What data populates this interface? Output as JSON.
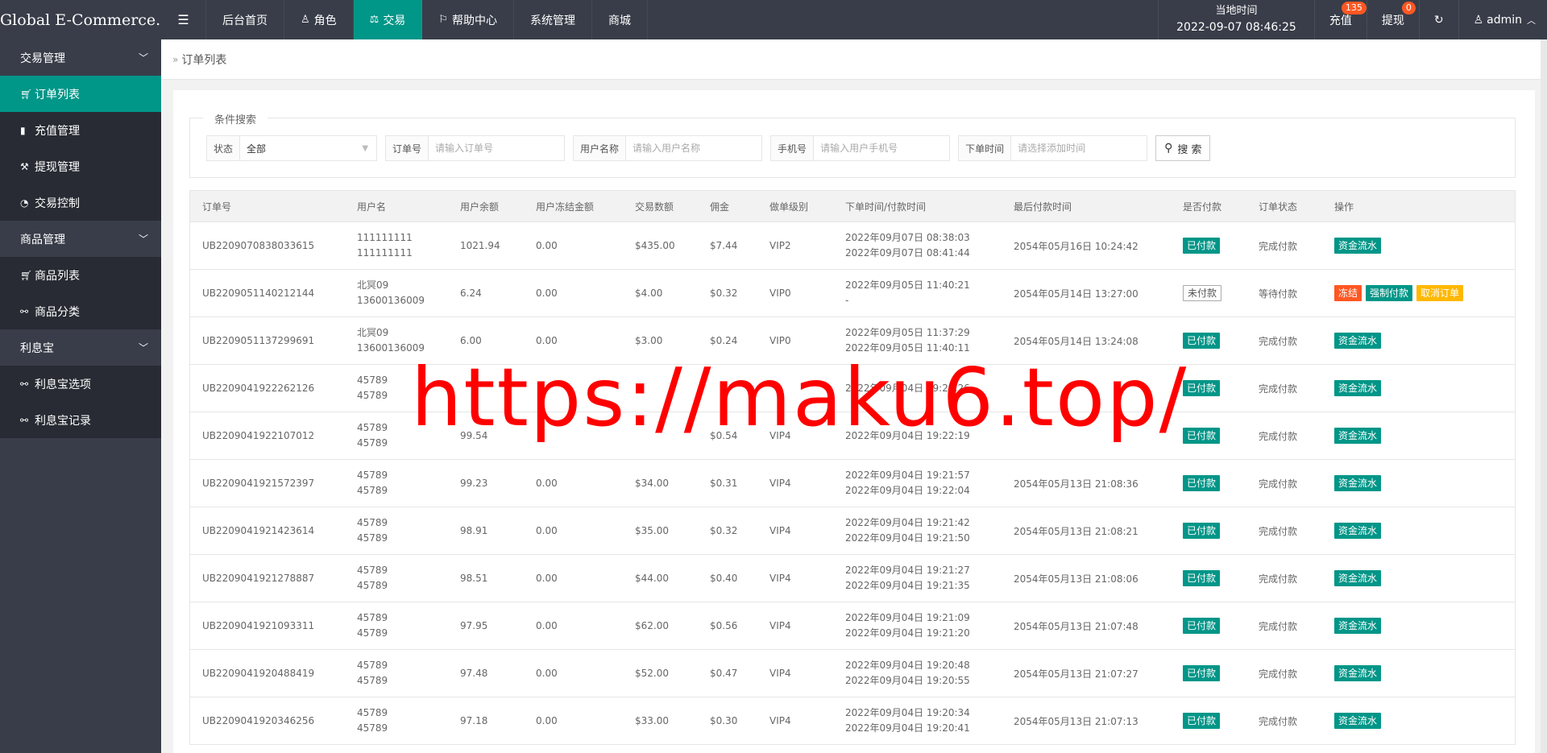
{
  "brand": "Global E-Commerce...",
  "topnav": [
    {
      "label": "后台首页",
      "icon": "",
      "active": false
    },
    {
      "label": "角色",
      "icon": "user-icon",
      "active": false
    },
    {
      "label": "交易",
      "icon": "scale-icon",
      "active": true
    },
    {
      "label": "帮助中心",
      "icon": "flag-icon",
      "active": false
    },
    {
      "label": "系统管理",
      "icon": "",
      "active": false
    },
    {
      "label": "商城",
      "icon": "",
      "active": false
    }
  ],
  "header": {
    "time_label": "当地时间",
    "time_value": "2022-09-07 08:46:25",
    "recharge_label": "充值",
    "recharge_badge": "135",
    "withdraw_label": "提现",
    "withdraw_badge": "0",
    "user": "admin"
  },
  "sidebar": {
    "groups": [
      {
        "label": "交易管理",
        "items": [
          {
            "label": "订单列表",
            "icon": "cart-icon",
            "active": true
          },
          {
            "label": "充值管理",
            "icon": "comment-icon",
            "active": false
          },
          {
            "label": "提现管理",
            "icon": "hammer-icon",
            "active": false
          },
          {
            "label": "交易控制",
            "icon": "dashboard-icon",
            "active": false
          }
        ]
      },
      {
        "label": "商品管理",
        "items": [
          {
            "label": "商品列表",
            "icon": "cart-icon",
            "active": false
          },
          {
            "label": "商品分类",
            "icon": "link-icon",
            "active": false
          }
        ]
      },
      {
        "label": "利息宝",
        "items": [
          {
            "label": "利息宝选项",
            "icon": "link-icon",
            "active": false
          },
          {
            "label": "利息宝记录",
            "icon": "link-icon",
            "active": false
          }
        ]
      }
    ]
  },
  "breadcrumb": "订单列表",
  "search": {
    "legend": "条件搜索",
    "status_label": "状态",
    "status_value": "全部",
    "order_label": "订单号",
    "order_placeholder": "请输入订单号",
    "username_label": "用户名称",
    "username_placeholder": "请输入用户名称",
    "phone_label": "手机号",
    "phone_placeholder": "请输入用户手机号",
    "time_label": "下单时间",
    "time_placeholder": "请选择添加时间",
    "button": "搜 索"
  },
  "table": {
    "headers": [
      "订单号",
      "用户名",
      "用户余额",
      "用户冻结金额",
      "交易数额",
      "佣金",
      "做单级别",
      "下单时间/付款时间",
      "最后付款时间",
      "是否付款",
      "订单状态",
      "操作"
    ],
    "rows": [
      {
        "order": "UB2209070838033615",
        "user1": "111111111",
        "user2": "111111111",
        "balance": "1021.94",
        "frozen": "0.00",
        "amount": "$435.00",
        "commission": "$7.44",
        "vip": "VIP2",
        "t1": "2022年09月07日 08:38:03",
        "t2": "2022年09月07日 08:41:44",
        "last": "2054年05月16日 10:24:42",
        "paid": "已付款",
        "status": "完成付款",
        "ops": [
          "资金流水"
        ]
      },
      {
        "order": "UB2209051140212144",
        "user1": "北冥09",
        "user2": "13600136009",
        "balance": "6.24",
        "frozen": "0.00",
        "amount": "$4.00",
        "commission": "$0.32",
        "vip": "VIP0",
        "t1": "2022年09月05日 11:40:21",
        "t2": "-",
        "last": "2054年05月14日 13:27:00",
        "paid": "未付款",
        "status": "等待付款",
        "ops": [
          "冻结",
          "强制付款",
          "取消订单"
        ]
      },
      {
        "order": "UB2209051137299691",
        "user1": "北冥09",
        "user2": "13600136009",
        "balance": "6.00",
        "frozen": "0.00",
        "amount": "$3.00",
        "commission": "$0.24",
        "vip": "VIP0",
        "t1": "2022年09月05日 11:37:29",
        "t2": "2022年09月05日 11:40:11",
        "last": "2054年05月14日 13:24:08",
        "paid": "已付款",
        "status": "完成付款",
        "ops": [
          "资金流水"
        ]
      },
      {
        "order": "UB2209041922262126",
        "user1": "45789",
        "user2": "45789",
        "balance": "",
        "frozen": "",
        "amount": "",
        "commission": "",
        "vip": "",
        "t1": "2022年09月04日 19:22:26",
        "t2": "",
        "last": "",
        "paid": "已付款",
        "status": "完成付款",
        "ops": [
          "资金流水"
        ]
      },
      {
        "order": "UB2209041922107012",
        "user1": "45789",
        "user2": "45789",
        "balance": "99.54",
        "frozen": "",
        "amount": "",
        "commission": "$0.54",
        "vip": "VIP4",
        "t1": "",
        "t2": "2022年09月04日 19:22:19",
        "last": "",
        "paid": "已付款",
        "status": "完成付款",
        "ops": [
          "资金流水"
        ]
      },
      {
        "order": "UB2209041921572397",
        "user1": "45789",
        "user2": "45789",
        "balance": "99.23",
        "frozen": "0.00",
        "amount": "$34.00",
        "commission": "$0.31",
        "vip": "VIP4",
        "t1": "2022年09月04日 19:21:57",
        "t2": "2022年09月04日 19:22:04",
        "last": "2054年05月13日 21:08:36",
        "paid": "已付款",
        "status": "完成付款",
        "ops": [
          "资金流水"
        ]
      },
      {
        "order": "UB2209041921423614",
        "user1": "45789",
        "user2": "45789",
        "balance": "98.91",
        "frozen": "0.00",
        "amount": "$35.00",
        "commission": "$0.32",
        "vip": "VIP4",
        "t1": "2022年09月04日 19:21:42",
        "t2": "2022年09月04日 19:21:50",
        "last": "2054年05月13日 21:08:21",
        "paid": "已付款",
        "status": "完成付款",
        "ops": [
          "资金流水"
        ]
      },
      {
        "order": "UB2209041921278887",
        "user1": "45789",
        "user2": "45789",
        "balance": "98.51",
        "frozen": "0.00",
        "amount": "$44.00",
        "commission": "$0.40",
        "vip": "VIP4",
        "t1": "2022年09月04日 19:21:27",
        "t2": "2022年09月04日 19:21:35",
        "last": "2054年05月13日 21:08:06",
        "paid": "已付款",
        "status": "完成付款",
        "ops": [
          "资金流水"
        ]
      },
      {
        "order": "UB2209041921093311",
        "user1": "45789",
        "user2": "45789",
        "balance": "97.95",
        "frozen": "0.00",
        "amount": "$62.00",
        "commission": "$0.56",
        "vip": "VIP4",
        "t1": "2022年09月04日 19:21:09",
        "t2": "2022年09月04日 19:21:20",
        "last": "2054年05月13日 21:07:48",
        "paid": "已付款",
        "status": "完成付款",
        "ops": [
          "资金流水"
        ]
      },
      {
        "order": "UB2209041920488419",
        "user1": "45789",
        "user2": "45789",
        "balance": "97.48",
        "frozen": "0.00",
        "amount": "$52.00",
        "commission": "$0.47",
        "vip": "VIP4",
        "t1": "2022年09月04日 19:20:48",
        "t2": "2022年09月04日 19:20:55",
        "last": "2054年05月13日 21:07:27",
        "paid": "已付款",
        "status": "完成付款",
        "ops": [
          "资金流水"
        ]
      },
      {
        "order": "UB2209041920346256",
        "user1": "45789",
        "user2": "45789",
        "balance": "97.18",
        "frozen": "0.00",
        "amount": "$33.00",
        "commission": "$0.30",
        "vip": "VIP4",
        "t1": "2022年09月04日 19:20:34",
        "t2": "2022年09月04日 19:20:41",
        "last": "2054年05月13日 21:07:13",
        "paid": "已付款",
        "status": "完成付款",
        "ops": [
          "资金流水"
        ]
      }
    ]
  },
  "watermark": "https://maku6.top/",
  "colors": {
    "topbar": "#393d49",
    "accent": "#009688",
    "orange": "#ff5722",
    "yellow": "#ffb800",
    "watermark": "#ff0000"
  }
}
